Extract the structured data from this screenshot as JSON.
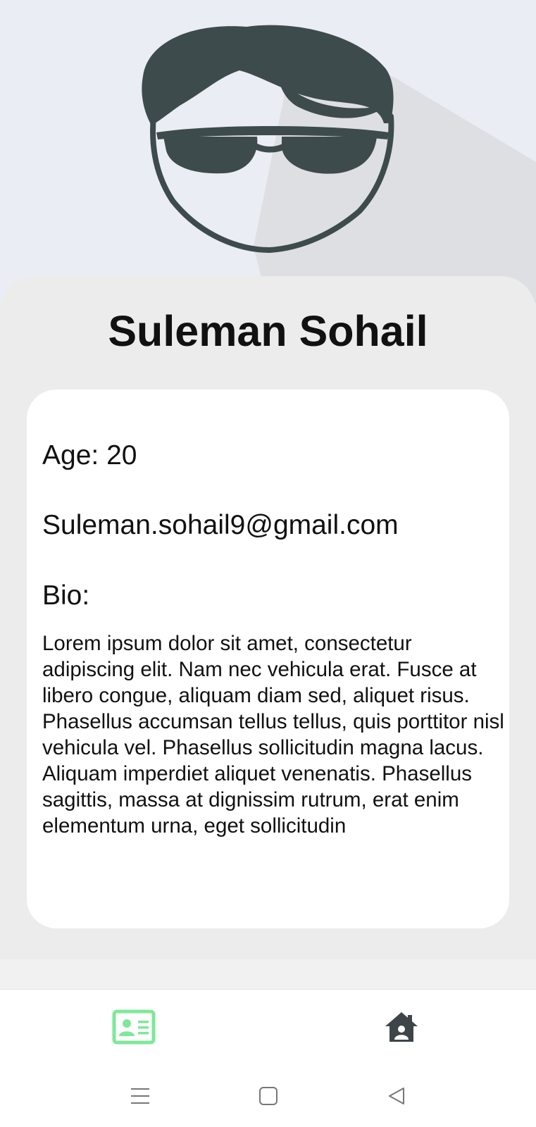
{
  "profile": {
    "name": "Suleman Sohail",
    "age": "Age: 20",
    "email": "Suleman.sohail9@gmail.com",
    "bio_label": "Bio:",
    "bio_text": "Lorem ipsum dolor sit amet, consectetur adipiscing elit. Nam nec vehicula erat. Fusce at libero congue, aliquam diam sed, aliquet risus. Phasellus accumsan tellus tellus, quis porttitor nisl vehicula vel. Phasellus sollicitudin magna lacus. Aliquam imperdiet aliquet venenatis. Phasellus sagittis, massa at dignissim rutrum, erat enim elementum urna, eget sollicitudin"
  },
  "avatar": {
    "icon": "sunglasses-avatar-icon",
    "color": "#3e4b4d"
  },
  "bottom_nav": {
    "items": [
      {
        "icon": "profile-card-icon",
        "active": true,
        "color": "#7ee89a"
      },
      {
        "icon": "home-icon",
        "active": false,
        "color": "#3e4548"
      }
    ]
  },
  "system_nav": {
    "buttons": [
      "menu-icon",
      "home-square-icon",
      "back-triangle-icon"
    ]
  },
  "colors": {
    "header_bg": "#eaedf4",
    "panel_bg": "#ececec",
    "card_bg": "#ffffff",
    "text": "#111111"
  }
}
